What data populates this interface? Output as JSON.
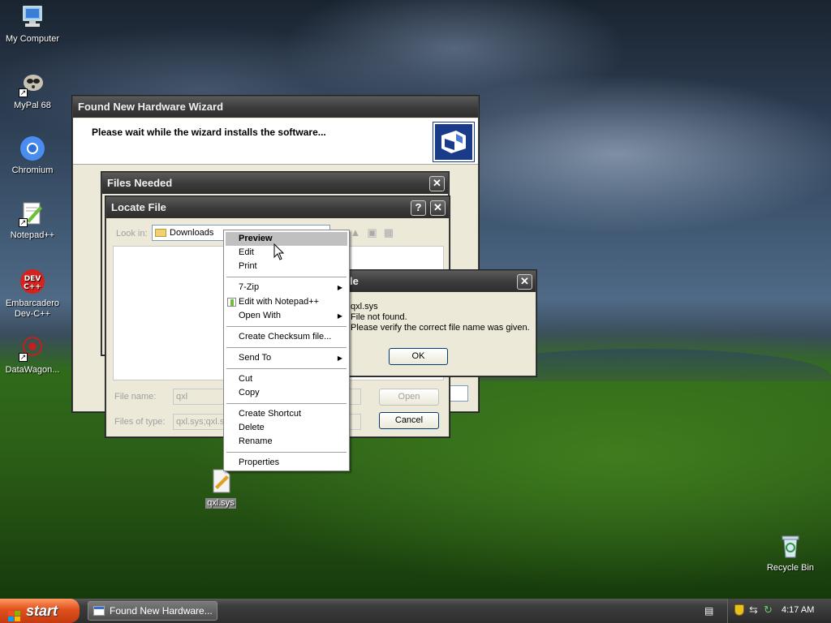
{
  "desktop": {
    "icons": [
      {
        "label": "My Computer"
      },
      {
        "label": "MyPal 68"
      },
      {
        "label": "Chromium"
      },
      {
        "label": "Notepad++"
      },
      {
        "label": "Embarcadero Dev-C++"
      },
      {
        "label": "DataWagon..."
      },
      {
        "label": "qxl.sys"
      },
      {
        "label": "Recycle Bin"
      }
    ]
  },
  "wizard": {
    "title": "Found New Hardware Wizard",
    "heading": "Please wait while the wizard installs the software..."
  },
  "files_needed": {
    "title": "Files Needed"
  },
  "locate_file": {
    "title": "Locate File",
    "help_button": "?",
    "close_button": "✕",
    "look_in_label": "Look in:",
    "look_in_value": "Downloads",
    "file_name_label": "File name:",
    "file_name_value": "qxl",
    "files_of_type_label": "Files of type:",
    "files_of_type_value": "qxl.sys;qxl.sy",
    "open_button": "Open",
    "cancel_button": "Cancel"
  },
  "error_dialog": {
    "title_fragment": "le",
    "line1": "qxl.sys",
    "line2": "File not found.",
    "line3": "Please verify the correct file name was given.",
    "ok_button": "OK"
  },
  "context_menu": {
    "items": [
      {
        "label": "Preview"
      },
      {
        "label": "Edit"
      },
      {
        "label": "Print"
      },
      {
        "label": "7-Zip"
      },
      {
        "label": "Edit with Notepad++"
      },
      {
        "label": "Open With"
      },
      {
        "label": "Create Checksum file..."
      },
      {
        "label": "Send To"
      },
      {
        "label": "Cut"
      },
      {
        "label": "Copy"
      },
      {
        "label": "Create Shortcut"
      },
      {
        "label": "Delete"
      },
      {
        "label": "Rename"
      },
      {
        "label": "Properties"
      }
    ]
  },
  "taskbar": {
    "start_label": "start",
    "task_label": "Found New Hardware...",
    "clock": "4:17 AM"
  }
}
